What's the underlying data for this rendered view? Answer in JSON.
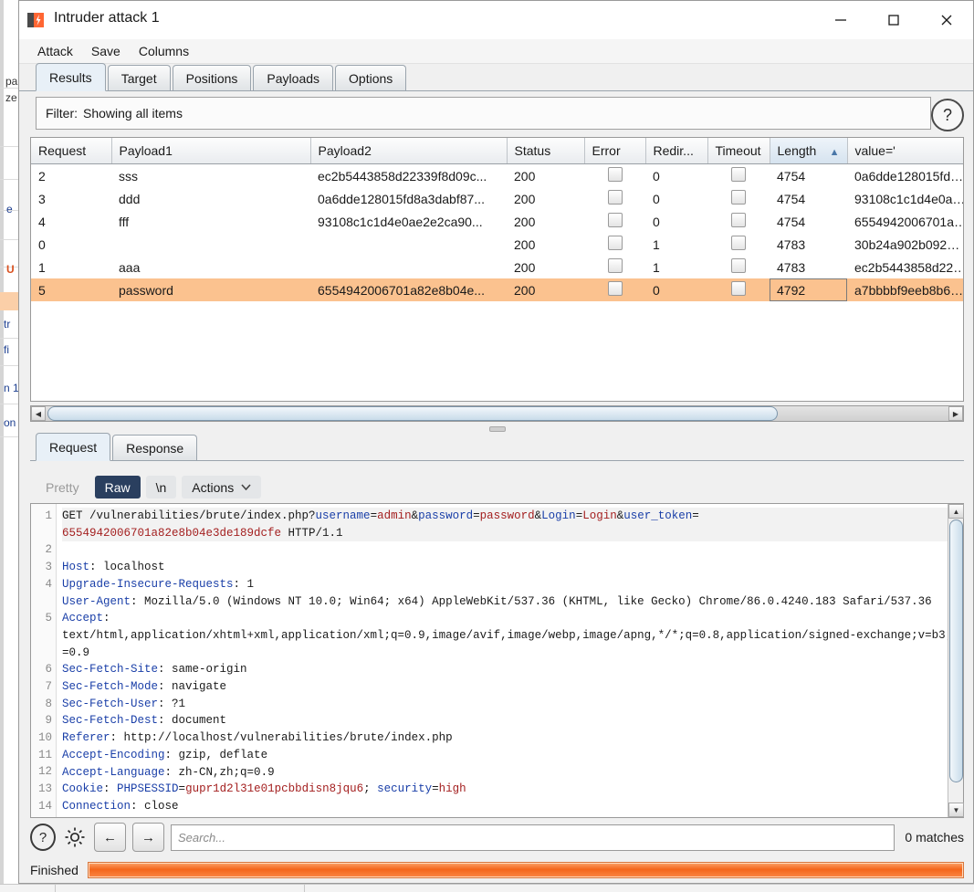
{
  "window": {
    "title": "Intruder attack 1",
    "icon": "burp-logo-icon",
    "minimize": "—",
    "maximize": "□",
    "close": "✕"
  },
  "menubar": {
    "items": [
      {
        "label": "Attack"
      },
      {
        "label": "Save"
      },
      {
        "label": "Columns"
      }
    ]
  },
  "tabs": {
    "items": [
      {
        "label": "Results",
        "active": true
      },
      {
        "label": "Target",
        "active": false
      },
      {
        "label": "Positions",
        "active": false
      },
      {
        "label": "Payloads",
        "active": false
      },
      {
        "label": "Options",
        "active": false
      }
    ]
  },
  "filter": {
    "label": "Filter:",
    "value": "Showing all items",
    "help_icon": "question-mark-icon"
  },
  "results_table": {
    "columns": [
      {
        "key": "request",
        "label": "Request",
        "sorted": false
      },
      {
        "key": "payload1",
        "label": "Payload1",
        "sorted": false
      },
      {
        "key": "payload2",
        "label": "Payload2",
        "sorted": false
      },
      {
        "key": "status",
        "label": "Status",
        "sorted": false
      },
      {
        "key": "error",
        "label": "Error",
        "sorted": false
      },
      {
        "key": "redirect",
        "label": "Redir...",
        "sorted": false
      },
      {
        "key": "timeout",
        "label": "Timeout",
        "sorted": false
      },
      {
        "key": "length",
        "label": "Length",
        "sorted": true,
        "sort_dir": "▲"
      },
      {
        "key": "value",
        "label": "value='",
        "sorted": false
      }
    ],
    "rows": [
      {
        "request": "2",
        "payload1": "sss",
        "payload2": "ec2b5443858d22339f8d09c...",
        "status": "200",
        "error": false,
        "redirect": "0",
        "timeout": false,
        "length": "4754",
        "value": "0a6dde128015fd…",
        "selected": false
      },
      {
        "request": "3",
        "payload1": "ddd",
        "payload2": "0a6dde128015fd8a3dabf87...",
        "status": "200",
        "error": false,
        "redirect": "0",
        "timeout": false,
        "length": "4754",
        "value": "93108c1c1d4e0a…",
        "selected": false
      },
      {
        "request": "4",
        "payload1": "fff",
        "payload2": "93108c1c1d4e0ae2e2ca90...",
        "status": "200",
        "error": false,
        "redirect": "0",
        "timeout": false,
        "length": "4754",
        "value": "6554942006701a…",
        "selected": false
      },
      {
        "request": "0",
        "payload1": "",
        "payload2": "",
        "status": "200",
        "error": false,
        "redirect": "1",
        "timeout": false,
        "length": "4783",
        "value": "30b24a902b092…",
        "selected": false
      },
      {
        "request": "1",
        "payload1": "aaa",
        "payload2": "",
        "status": "200",
        "error": false,
        "redirect": "1",
        "timeout": false,
        "length": "4783",
        "value": "ec2b5443858d22…",
        "selected": false
      },
      {
        "request": "5",
        "payload1": "password",
        "payload2": "6554942006701a82e8b04e...",
        "status": "200",
        "error": false,
        "redirect": "0",
        "timeout": false,
        "length": "4792",
        "value": "a7bbbbf9eeb8b6…",
        "selected": true
      }
    ]
  },
  "message_tabs": {
    "items": [
      {
        "label": "Request",
        "active": true
      },
      {
        "label": "Response",
        "active": false
      }
    ]
  },
  "view_toolbar": {
    "pretty": "Pretty",
    "raw": "Raw",
    "newline": "\\n",
    "actions": "Actions",
    "actions_caret": "⌄",
    "selected": "Raw"
  },
  "request": {
    "line_numbers": [
      "1",
      "2",
      "3",
      "4",
      "5",
      "6",
      "7",
      "8",
      "9",
      "10",
      "11",
      "12",
      "13",
      "14"
    ],
    "line1": {
      "method_path": "GET /vulnerabilities/brute/index.php?",
      "params": [
        {
          "name": "username",
          "value": "admin"
        },
        {
          "name": "password",
          "value": "password"
        },
        {
          "name": "Login",
          "value": "Login"
        },
        {
          "name": "user_token",
          "value": "6554942006701a82e8b04e3de189dcfe"
        }
      ],
      "protocol": " HTTP/1.1"
    },
    "headers": [
      {
        "name": "Host",
        "value": " localhost"
      },
      {
        "name": "Upgrade-Insecure-Requests",
        "value": " 1"
      },
      {
        "name": "User-Agent",
        "value": " Mozilla/5.0 (Windows NT 10.0; Win64; x64) AppleWebKit/537.36 (KHTML, like Gecko) Chrome/86.0.4240.183 Safari/537.36"
      },
      {
        "name": "Accept",
        "value": "\ntext/html,application/xhtml+xml,application/xml;q=0.9,image/avif,image/webp,image/apng,*/*;q=0.8,application/signed-exchange;v=b3;q=0.9"
      },
      {
        "name": "Sec-Fetch-Site",
        "value": " same-origin"
      },
      {
        "name": "Sec-Fetch-Mode",
        "value": " navigate"
      },
      {
        "name": "Sec-Fetch-User",
        "value": " ?1"
      },
      {
        "name": "Sec-Fetch-Dest",
        "value": " document"
      },
      {
        "name": "Referer",
        "value": " http://localhost/vulnerabilities/brute/index.php"
      },
      {
        "name": "Accept-Encoding",
        "value": " gzip, deflate"
      },
      {
        "name": "Accept-Language",
        "value": " zh-CN,zh;q=0.9"
      },
      {
        "name": "Connection",
        "value": " close"
      }
    ],
    "cookie": {
      "name": "Cookie",
      "pairs": [
        {
          "name": "PHPSESSID",
          "value": "gupr1d2l31e01pcbbdisn8jqu6"
        },
        {
          "name": "security",
          "value": "high"
        }
      ]
    }
  },
  "search": {
    "help_icon": "question-mark-icon",
    "settings_icon": "gear-icon",
    "prev_icon": "←",
    "next_icon": "→",
    "placeholder": "Search...",
    "value": "",
    "matches": "0 matches"
  },
  "status": {
    "label": "Finished",
    "progress_percent": 100,
    "progress_color": "#f4661b"
  },
  "scrollbars": {
    "left_arrow": "◀",
    "right_arrow": "▶",
    "up_arrow": "▲",
    "down_arrow": "▼"
  },
  "background_window": {
    "fragments": [
      "pa",
      "ze",
      "e",
      "U",
      "tr",
      "fi",
      "n 1",
      "on"
    ]
  }
}
